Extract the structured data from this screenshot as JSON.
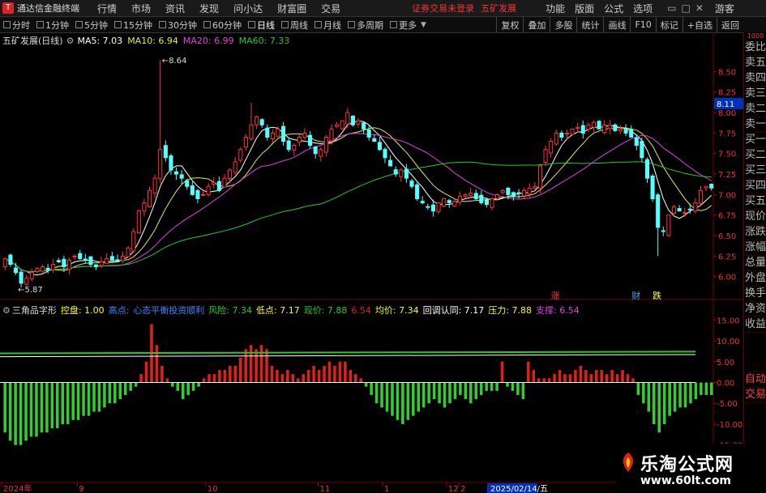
{
  "menubar": {
    "app_title": "通达信金融终端",
    "items": [
      "行情",
      "市场",
      "资讯",
      "发现",
      "问小达",
      "财富圈",
      "交易"
    ],
    "notice": "证券交易未登录",
    "stock_name": "五矿发展",
    "right_items": [
      "功能",
      "版面",
      "公式",
      "选项"
    ],
    "guest": "游客"
  },
  "periodbar": {
    "items": [
      "分时",
      "1分钟",
      "5分钟",
      "15分钟",
      "30分钟",
      "60分钟",
      "日线",
      "周线",
      "月线",
      "多周期",
      "更多"
    ],
    "active": "日线",
    "right_buttons": [
      "复权",
      "叠加",
      "多股",
      "统计",
      "画线",
      "F10",
      "标记",
      "+自选",
      "返回"
    ]
  },
  "sidepanel": {
    "top_label": "1000",
    "items": [
      "委比",
      "卖五",
      "卖四",
      "卖三",
      "卖二",
      "卖一",
      "买一",
      "买二",
      "买三",
      "买四",
      "买五",
      "现价",
      "涨跌",
      "涨幅",
      "总量",
      "外盘",
      "换手",
      "净资",
      "收益",
      "",
      "自动",
      "交易"
    ]
  },
  "colors": {
    "up": "#ff3232",
    "down": "#54ffff",
    "ma5": "#ffffff",
    "ma10": "#e8e84a",
    "ma20": "#e040e0",
    "ma60": "#22cc22",
    "osc_up": "#dd2020",
    "osc_down": "#33cc33"
  },
  "chart_data": [
    {
      "type": "candlestick",
      "title": "五矿发展(日线)",
      "legend": [
        {
          "label": "MA5: 7.03",
          "color": "#ffffff"
        },
        {
          "label": "MA10: 6.94",
          "color": "#e8e84a"
        },
        {
          "label": "MA20: 6.99",
          "color": "#e040e0"
        },
        {
          "label": "MA60: 7.33",
          "color": "#22cc22"
        }
      ],
      "ylim": [
        5.8,
        8.8
      ],
      "yticks": [
        6.0,
        6.25,
        6.5,
        6.75,
        7.0,
        7.25,
        7.5,
        7.75,
        8.0,
        8.25,
        8.5
      ],
      "ytick_labels": [
        "6.00",
        "6.25",
        "6.50",
        "6.75",
        "7.00",
        "7.25",
        "7.50",
        "7.75",
        "8.00",
        "8.25",
        "8.50"
      ],
      "current_price_label": "8.11",
      "high_marker": "8.64",
      "low_marker": "5.87",
      "event_marks": [
        "涨",
        "财",
        "跌"
      ],
      "closes": [
        6.22,
        6.15,
        6.05,
        5.92,
        5.98,
        6.05,
        6.1,
        6.12,
        6.08,
        6.15,
        6.18,
        6.12,
        6.2,
        6.25,
        6.22,
        6.2,
        6.15,
        6.12,
        6.18,
        6.22,
        6.2,
        6.18,
        6.25,
        6.35,
        6.55,
        6.8,
        6.9,
        7.05,
        7.2,
        7.55,
        7.45,
        7.3,
        7.25,
        7.2,
        7.1,
        7.0,
        6.95,
        7.0,
        7.1,
        7.15,
        7.05,
        7.2,
        7.3,
        7.4,
        7.55,
        7.7,
        7.85,
        7.95,
        7.85,
        7.7,
        7.75,
        7.8,
        7.65,
        7.55,
        7.6,
        7.7,
        7.75,
        7.6,
        7.5,
        7.55,
        7.7,
        7.8,
        7.85,
        7.9,
        8.0,
        7.85,
        7.9,
        7.8,
        7.7,
        7.65,
        7.55,
        7.45,
        7.35,
        7.25,
        7.3,
        7.2,
        7.1,
        6.95,
        6.9,
        6.85,
        6.8,
        6.9,
        6.95,
        6.9,
        6.92,
        6.98,
        7.0,
        7.02,
        6.95,
        6.9,
        6.88,
        6.95,
        7.0,
        7.05,
        7.0,
        6.98,
        7.02,
        7.05,
        7.08,
        7.1,
        7.35,
        7.55,
        7.65,
        7.75,
        7.7,
        7.75,
        7.8,
        7.82,
        7.75,
        7.85,
        7.88,
        7.8,
        7.85,
        7.85,
        7.78,
        7.8,
        7.75,
        7.7,
        7.6,
        7.45,
        7.2,
        6.95,
        6.6,
        6.55,
        6.75,
        6.85,
        6.8,
        6.78,
        6.82,
        6.9,
        7.05,
        7.1,
        7.08
      ]
    },
    {
      "type": "bar",
      "title": "三角品字形",
      "legend": [
        {
          "label": "控盘: 1.00",
          "color": "#ffff00"
        },
        {
          "label": "高点:",
          "color": "#3388ff"
        },
        {
          "label": "心态平衡投资顺利",
          "color": "#3388ff"
        },
        {
          "label": "风险: 7.34",
          "color": "#22cc22"
        },
        {
          "label": "低点: 7.17",
          "color": "#ffff00"
        },
        {
          "label": "现价: 7.88",
          "color": "#22cc22"
        },
        {
          "label": "6.54",
          "color": "#dd2020"
        },
        {
          "label": "均价: 7.34",
          "color": "#ffff00"
        },
        {
          "label": "回调认同: 7.17",
          "color": "#ffffff"
        },
        {
          "label": "压力: 7.88",
          "color": "#ffff00"
        },
        {
          "label": "支撑: 6.54",
          "color": "#e040e0"
        }
      ],
      "ylim": [
        -17,
        17
      ],
      "yticks": [
        15,
        10,
        5,
        0,
        -5,
        -10,
        -15
      ],
      "ytick_labels": [
        "15.00",
        "10.00",
        "5.00",
        "0.00",
        "-5.00",
        "-10.00",
        "-15.00"
      ],
      "values": [
        -12,
        -14,
        -15,
        -15,
        -14,
        -13,
        -13,
        -12,
        -12,
        -11,
        -11,
        -10,
        -10,
        -9,
        -9,
        -8,
        -8,
        -7,
        -7,
        -6,
        -5,
        -5,
        -4,
        -3,
        -2,
        -1,
        2,
        5,
        14,
        9,
        4,
        1,
        -1,
        -2,
        -4,
        -3,
        -2,
        -1,
        1,
        2,
        2,
        3,
        3,
        4,
        4,
        6,
        8,
        9,
        8,
        9,
        8,
        4,
        3,
        2,
        3,
        2,
        1,
        2,
        3,
        4,
        3,
        4,
        5,
        4,
        5,
        5,
        3,
        2,
        1,
        -1,
        -3,
        -5,
        -6,
        -7,
        -8,
        -9,
        -10,
        -9,
        -8,
        -7,
        -6,
        -5,
        -4,
        -5,
        -6,
        -5,
        -4,
        -3,
        -4,
        -5,
        -4,
        -3,
        -2,
        -2,
        -2,
        5,
        -1,
        -2,
        -3,
        -4,
        5,
        3,
        1,
        1,
        1,
        2,
        3,
        2,
        2,
        3,
        4,
        3,
        2,
        3,
        3,
        2,
        3,
        2,
        3,
        2,
        1,
        -3,
        -5,
        -7,
        -10,
        -12,
        -10,
        -8,
        -7,
        -6,
        -6,
        -5,
        -4,
        -3,
        -3,
        -3
      ],
      "lines": [
        {
          "name": "",
          "start": 7.0,
          "end": 7.4,
          "color": "#22cc22"
        },
        {
          "name": "",
          "start": 6.2,
          "end": 6.7,
          "color": "#ffffff"
        },
        {
          "name": "",
          "start": 0.0,
          "end": 0.0,
          "color": "#ffffff"
        }
      ]
    }
  ],
  "xaxis": {
    "labels": [
      "2024年",
      "9",
      "10",
      "11",
      "12",
      "1",
      "2",
      "2025/02/14/五"
    ]
  },
  "watermark": {
    "title": "乐淘公式网",
    "url": "www.60lt.com"
  }
}
